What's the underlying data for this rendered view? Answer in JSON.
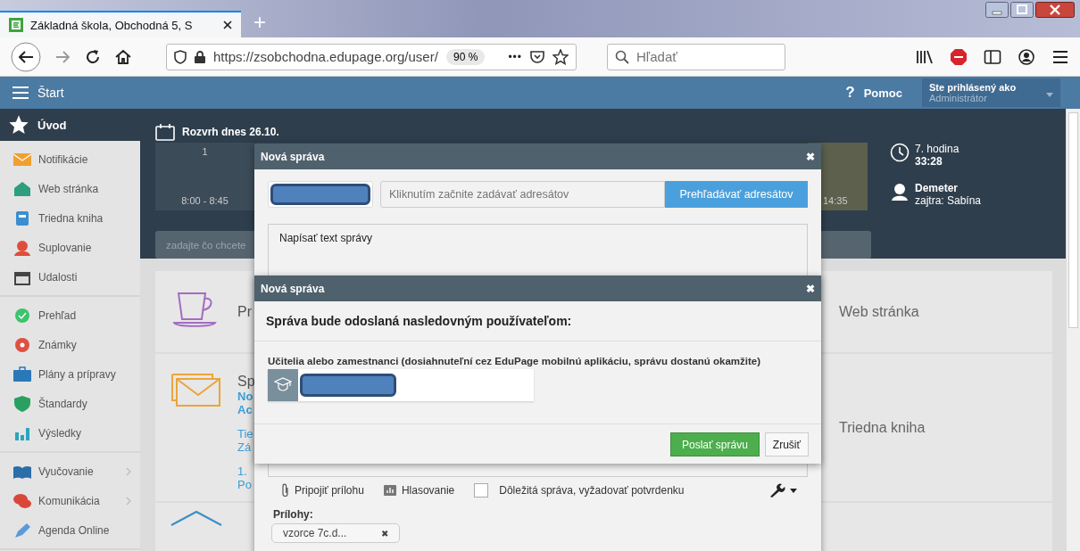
{
  "browser": {
    "tab_title": "Základná škola, Obchodná 5, S",
    "new_tab": "+",
    "url": "https://zsobchodna.edupage.org/user/",
    "zoom": "90 %",
    "more": "•••",
    "search_placeholder": "Hľadať"
  },
  "topbar": {
    "start": "Štart",
    "help_icon": "?",
    "help": "Pomoc",
    "login_label": "Ste prihlásený ako",
    "login_role": "Administrátor"
  },
  "sidebar": {
    "header": "Úvod",
    "groups": [
      [
        {
          "label": "Notifikácie",
          "color": "#f0a030",
          "has_submenu": false
        },
        {
          "label": "Web stránka",
          "color": "#2e9e7e",
          "has_submenu": false
        },
        {
          "label": "Triedna kniha",
          "color": "#3a8fd0",
          "has_submenu": false
        },
        {
          "label": "Suplovanie",
          "color": "#e04e3a",
          "has_submenu": false
        },
        {
          "label": "Udalosti",
          "color": "#444444",
          "has_submenu": false
        }
      ],
      [
        {
          "label": "Prehľad",
          "color": "#3cc36c",
          "has_submenu": false
        },
        {
          "label": "Známky",
          "color": "#e05040",
          "has_submenu": false
        },
        {
          "label": "Plány a prípravy",
          "color": "#2b78b8",
          "has_submenu": false
        },
        {
          "label": "Štandardy",
          "color": "#2aa060",
          "has_submenu": false
        },
        {
          "label": "Výsledky",
          "color": "#2aa5c0",
          "has_submenu": false
        }
      ],
      [
        {
          "label": "Vyučovanie",
          "color": "#2b6ea8",
          "has_submenu": true
        },
        {
          "label": "Komunikácia",
          "color": "#d9473a",
          "has_submenu": true
        },
        {
          "label": "Agenda Online",
          "color": "#5a9bd8",
          "has_submenu": false
        }
      ]
    ]
  },
  "timetable": {
    "title": "Rozvrh dnes 26.10.",
    "periods": [
      {
        "number": "1",
        "time": "8:00 - 8:45",
        "current": false
      },
      {
        "time": "14:35",
        "current": true
      }
    ]
  },
  "search": {
    "placeholder": "zadajte čo chcete"
  },
  "info": {
    "period": "7. hodina",
    "countdown": "33:28",
    "teacher": "Demeter",
    "tomorrow": "zajtra: Sabína"
  },
  "cards": [
    {
      "title": "Pr",
      "side_label": "Web stránka"
    },
    {
      "title": "Sp",
      "bold_links": [
        "No",
        "Ac"
      ],
      "links": [
        "Tie",
        "Zá"
      ],
      "more_links": [
        "1.",
        "Po"
      ],
      "side_label": "Triedna kniha"
    }
  ],
  "compose": {
    "title": "Nová správa",
    "close": "✖",
    "recipient_placeholder": "Kliknutím začnite zadávať adresátov",
    "browse": "Prehľadávať adresátov",
    "body_placeholder": "Napísať text správy",
    "attach": "Pripojiť prílohu",
    "poll": "Hlasovanie",
    "important": {
      "label": "Dôležitá správa, vyžadovať potvrdenku",
      "checked": false
    },
    "attachments_label": "Prílohy:",
    "attachments": [
      {
        "name": "vzorce 7c.d...",
        "remove": "✖"
      }
    ]
  },
  "confirm": {
    "title": "Nová správa",
    "close": "✖",
    "heading": "Správa bude odoslaná nasledovným používateľom:",
    "group_label": "Učitelia alebo zamestnanci (dosiahnuteľní cez EduPage mobilnú aplikáciu, správu dostanú okamžite)",
    "send": "Poslať správu",
    "cancel": "Zrušiť"
  }
}
